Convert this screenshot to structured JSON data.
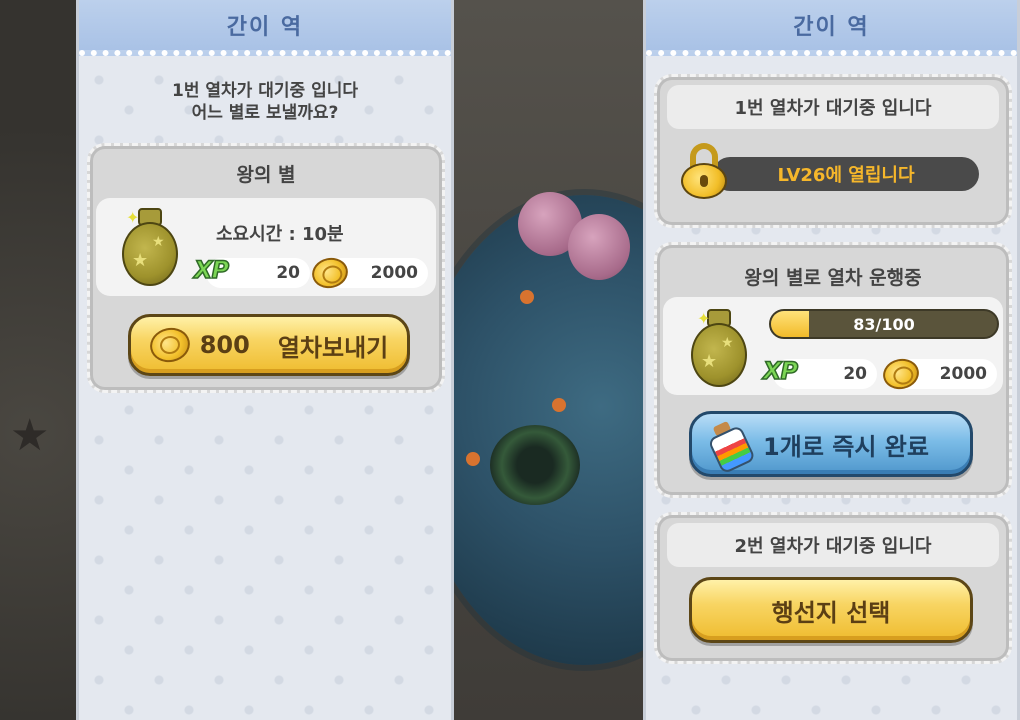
{
  "left_panel": {
    "title": "간이 역",
    "prompt_line1": "1번 열차가 대기중 입니다",
    "prompt_line2": "어느 별로 보낼까요?",
    "destination": {
      "name": "왕의 별",
      "travel_time": "소요시간 : 10분",
      "xp_label": "XP",
      "xp_value": "20",
      "coin_value": "2000"
    },
    "send_button": {
      "cost": "800",
      "label": "열차보내기"
    }
  },
  "right_panel": {
    "title": "간이 역",
    "slot1": {
      "status": "1번 열차가 대기중 입니다",
      "lock_text": "LV26에 열립니다"
    },
    "slot2": {
      "status": "왕의 별로 열차 운행중",
      "progress_text": "83/100",
      "progress_fraction": 0.17,
      "xp_label": "XP",
      "xp_value": "20",
      "coin_value": "2000",
      "instant_button_label": "1개로 즉시 완료"
    },
    "slot3": {
      "status": "2번 열차가 대기중 입니다",
      "select_button_label": "행선지 선택"
    }
  },
  "colors": {
    "header_blue": "#a9c2e6",
    "title_blue": "#4a6aa0",
    "button_yellow": "#f8d563",
    "button_blue": "#7bbce7",
    "lock_text_orange": "#f6b72b",
    "xp_green": "#7cd655"
  },
  "icons": [
    "star-bag-icon",
    "coin-icon",
    "xp-icon",
    "lock-icon",
    "potion-icon"
  ]
}
